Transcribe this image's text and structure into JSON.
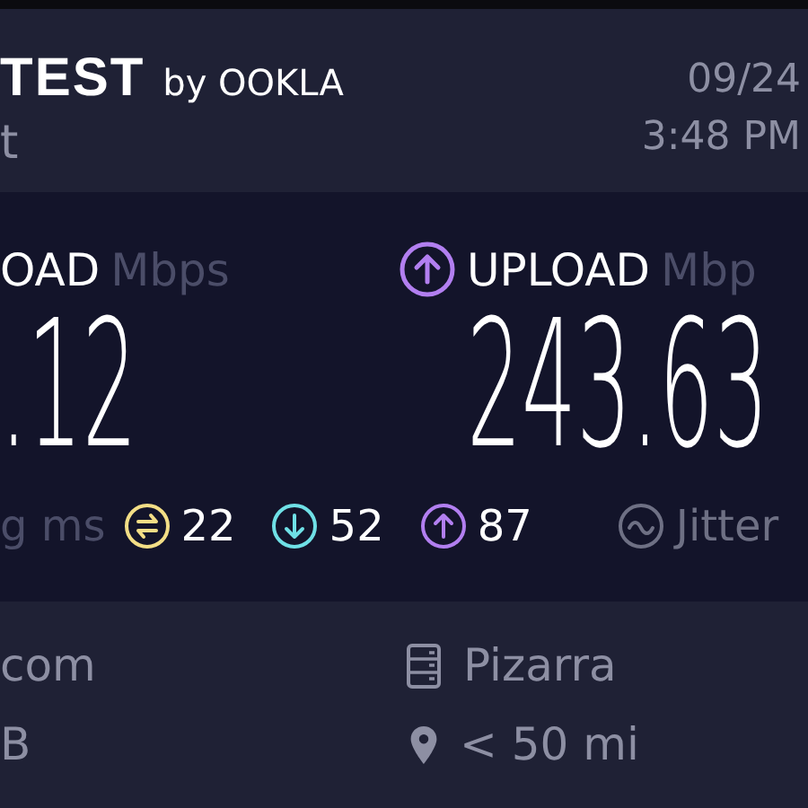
{
  "header": {
    "logo": "TEST",
    "logo_by": "by OOKLA",
    "subtitle": "t",
    "date": "09/24",
    "time": "3:48 PM"
  },
  "results": [
    {
      "kind": "download",
      "label": "OAD",
      "unit": "Mbps",
      "value": ".12"
    },
    {
      "kind": "upload",
      "label": "UPLOAD",
      "unit": "Mbp",
      "value": "243.63"
    }
  ],
  "ping": {
    "label": "g",
    "unit": "ms",
    "stats": [
      {
        "kind": "idle",
        "value": "22"
      },
      {
        "kind": "download",
        "value": "52"
      },
      {
        "kind": "upload",
        "value": "87"
      }
    ],
    "jitter_label": "Jitter"
  },
  "details": {
    "provider": "com",
    "provider_line_2": "B",
    "server": "Pizarra",
    "distance": "< 50 mi"
  }
}
